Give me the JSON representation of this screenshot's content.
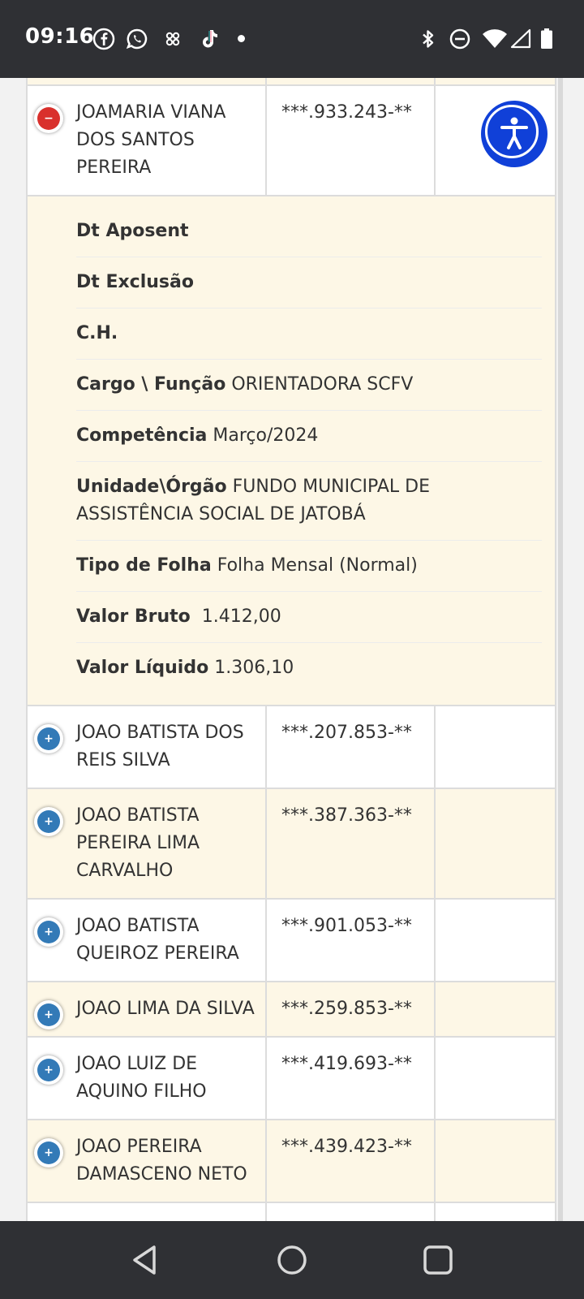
{
  "status_bar": {
    "time": "09:16",
    "left_icons": [
      "facebook-icon",
      "whatsapp-icon",
      "app-icon",
      "tiktok-icon",
      "notification-dot"
    ],
    "right_icons": [
      "bluetooth-icon",
      "do-not-disturb-icon",
      "wifi-icon",
      "signal-icon",
      "battery-icon"
    ]
  },
  "expanded_row": {
    "name": "JOAMARIA VIANA DOS SANTOS PEREIRA",
    "cpf": "***.933.243-**",
    "toggle": "minus",
    "details": [
      {
        "label": "Dt Aposent",
        "value": ""
      },
      {
        "label": "Dt Exclusão",
        "value": ""
      },
      {
        "label": "C.H.",
        "value": ""
      },
      {
        "label": "Cargo \\ Função",
        "value": "ORIENTADORA SCFV"
      },
      {
        "label": "Competência",
        "value": "Março/2024"
      },
      {
        "label": "Unidade\\Órgão",
        "value": "FUNDO MUNICIPAL DE ASSISTÊNCIA SOCIAL DE JATOBÁ"
      },
      {
        "label": "Tipo de Folha",
        "value": "Folha Mensal (Normal)"
      },
      {
        "label": "Valor Bruto",
        "value": "1.412,00"
      },
      {
        "label": "Valor Líquido",
        "value": "1.306,10"
      }
    ]
  },
  "rows": [
    {
      "name": "JOAO BATISTA DOS REIS SILVA",
      "cpf": "***.207.853-**"
    },
    {
      "name": "JOAO BATISTA PEREIRA LIMA CARVALHO",
      "cpf": "***.387.363-**"
    },
    {
      "name": "JOAO BATISTA QUEIROZ PEREIRA",
      "cpf": "***.901.053-**"
    },
    {
      "name": "JOAO LIMA DA SILVA",
      "cpf": "***.259.853-**"
    },
    {
      "name": "JOAO LUIZ DE AQUINO FILHO",
      "cpf": "***.419.693-**"
    },
    {
      "name": "JOAO PEREIRA DAMASCENO NETO",
      "cpf": "***.439.423-**"
    }
  ],
  "accessibility_button": "accessibility-icon",
  "nav_bar": [
    "back-icon",
    "home-icon",
    "recents-icon"
  ],
  "colors": {
    "status_bar_bg": "#2f3034",
    "row_cream": "#fdf7e6",
    "toggle_plus": "#337ab7",
    "toggle_minus": "#d9302c",
    "accessibility_blue": "#1040d8"
  }
}
